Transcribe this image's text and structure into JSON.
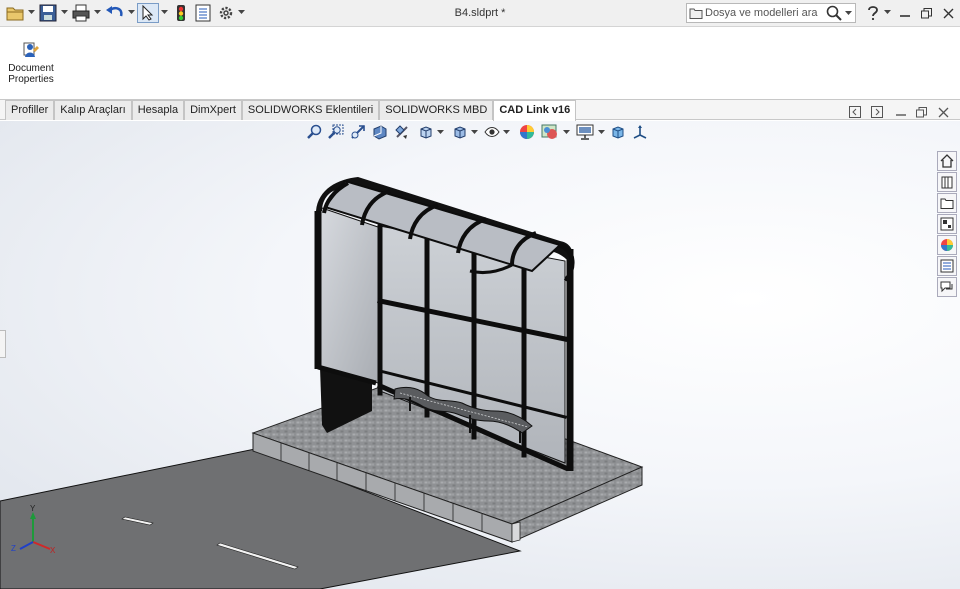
{
  "window": {
    "title": "B4.sldprt *"
  },
  "search": {
    "placeholder": "Dosya ve modelleri ara"
  },
  "ribbon": {
    "document_properties_label": "Document Properties"
  },
  "tabs": [
    {
      "label": "Profiller",
      "active": false
    },
    {
      "label": "Kalıp Araçları",
      "active": false
    },
    {
      "label": "Hesapla",
      "active": false
    },
    {
      "label": "DimXpert",
      "active": false
    },
    {
      "label": "SOLIDWORKS Eklentileri",
      "active": false
    },
    {
      "label": "SOLIDWORKS MBD",
      "active": false
    },
    {
      "label": "CAD Link v16",
      "active": true
    }
  ],
  "quick_access_icons": [
    "new-document-icon",
    "save-icon",
    "print-icon",
    "undo-icon",
    "select-arrow-icon",
    "rebuild-traffic-light-icon",
    "file-properties-icon",
    "options-gear-icon"
  ],
  "heads_up_toolbar_icons": [
    "zoom-to-fit-icon",
    "zoom-to-area-icon",
    "previous-view-icon",
    "section-view-icon",
    "dynamic-annotation-icon",
    "view-orientation-icon",
    "display-style-icon",
    "hide-show-items-icon",
    "edit-appearance-icon",
    "apply-scene-icon",
    "view-settings-icon",
    "3d-view-icon",
    "axis-triad-icon"
  ],
  "task_pane_icons": [
    "solidworks-resources-icon",
    "design-library-icon",
    "file-explorer-icon",
    "view-palette-icon",
    "appearances-scenes-icon",
    "custom-properties-icon",
    "solidworks-forum-icon"
  ],
  "triad": {
    "x": "X",
    "y": "Y",
    "z": "Z"
  },
  "colors": {
    "accent": "#1f5fbf",
    "frame": "#0d0d0d",
    "glass": "#bfc3c8",
    "pavement": "#8d8f92",
    "road": "#6e6f71"
  }
}
